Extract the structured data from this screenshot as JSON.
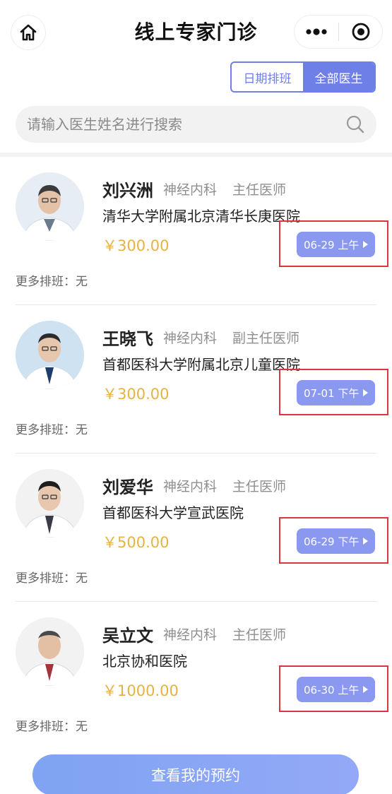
{
  "header": {
    "title": "线上专家门诊",
    "home_icon": "home-icon",
    "more_icon": "more-dots-icon",
    "close_icon": "target-close-icon"
  },
  "segment": {
    "options": [
      "日期排班",
      "全部医生"
    ],
    "active_index": 1
  },
  "search": {
    "placeholder": "请输入医生姓名进行搜索",
    "value": ""
  },
  "doctors": [
    {
      "name": "刘兴洲",
      "department": "神经内科",
      "title": "主任医师",
      "hospital": "清华大学附属北京清华长庚医院",
      "price": "￥300.00",
      "slot": "06-29 上午",
      "more": "更多排班：无"
    },
    {
      "name": "王晓飞",
      "department": "神经内科",
      "title": "副主任医师",
      "hospital": "首都医科大学附属北京儿童医院",
      "price": "￥300.00",
      "slot": "07-01 下午",
      "more": "更多排班：无"
    },
    {
      "name": "刘爱华",
      "department": "神经内科",
      "title": "主任医师",
      "hospital": "首都医科大学宣武医院",
      "price": "￥500.00",
      "slot": "06-29 下午",
      "more": "更多排班：无"
    },
    {
      "name": "吴立文",
      "department": "神经内科",
      "title": "主任医师",
      "hospital": "北京协和医院",
      "price": "￥1000.00",
      "slot": "06-30 上午",
      "more": "更多排班：无"
    }
  ],
  "footer": {
    "button_label": "查看我的预约"
  },
  "colors": {
    "accent": "#6f7fe8",
    "slot": "#8a98f0",
    "price": "#e6b342",
    "highlight": "#d9363e"
  }
}
